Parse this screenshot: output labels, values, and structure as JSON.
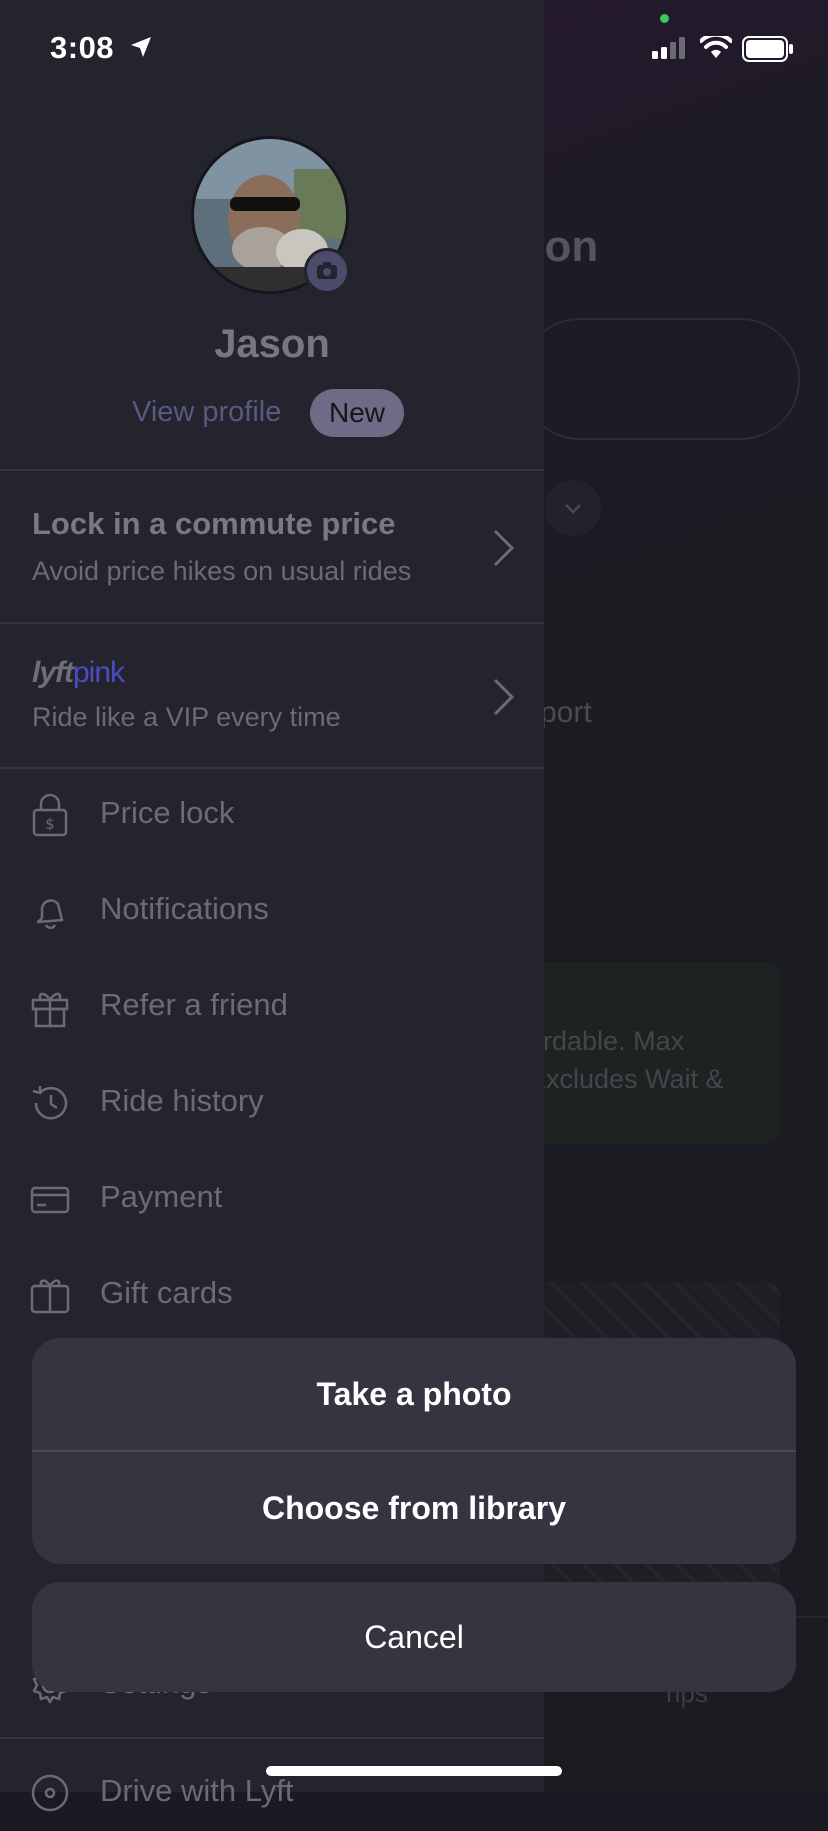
{
  "status_bar": {
    "time": "3:08"
  },
  "background": {
    "title_fragment": "son",
    "airport_fragment": "rport",
    "card_line1": "ordable. Max",
    "card_line2": "Excludes Wait &",
    "trips_fragment": "rips"
  },
  "profile": {
    "name": "Jason",
    "view_profile": "View profile",
    "new_badge": "New"
  },
  "promos": {
    "commute": {
      "title": "Lock in a commute price",
      "subtitle": "Avoid price hikes on usual rides"
    },
    "lyft_pink": {
      "logo_lyft": "lyft",
      "logo_pink": "pink",
      "subtitle": "Ride like a VIP every time"
    }
  },
  "menu": {
    "items": [
      {
        "label": "Price lock",
        "icon": "lock-dollar-icon"
      },
      {
        "label": "Notifications",
        "icon": "bell-icon"
      },
      {
        "label": "Refer a friend",
        "icon": "gift-icon"
      },
      {
        "label": "Ride history",
        "icon": "history-icon"
      },
      {
        "label": "Payment",
        "icon": "credit-card-icon"
      },
      {
        "label": "Gift cards",
        "icon": "gift-card-icon"
      }
    ],
    "partial_items": [
      {
        "label": "Settings",
        "icon": "gear-icon"
      },
      {
        "label": "Drive with Lyft",
        "icon": "steering-wheel-icon"
      }
    ]
  },
  "action_sheet": {
    "take_photo": "Take a photo",
    "choose_library": "Choose from library",
    "cancel": "Cancel"
  },
  "colors": {
    "drawer_bg": "#24242e",
    "sheet_bg": "#353440",
    "badge_bg": "#6d6b86",
    "pink_logo": "#4b4cc0"
  }
}
